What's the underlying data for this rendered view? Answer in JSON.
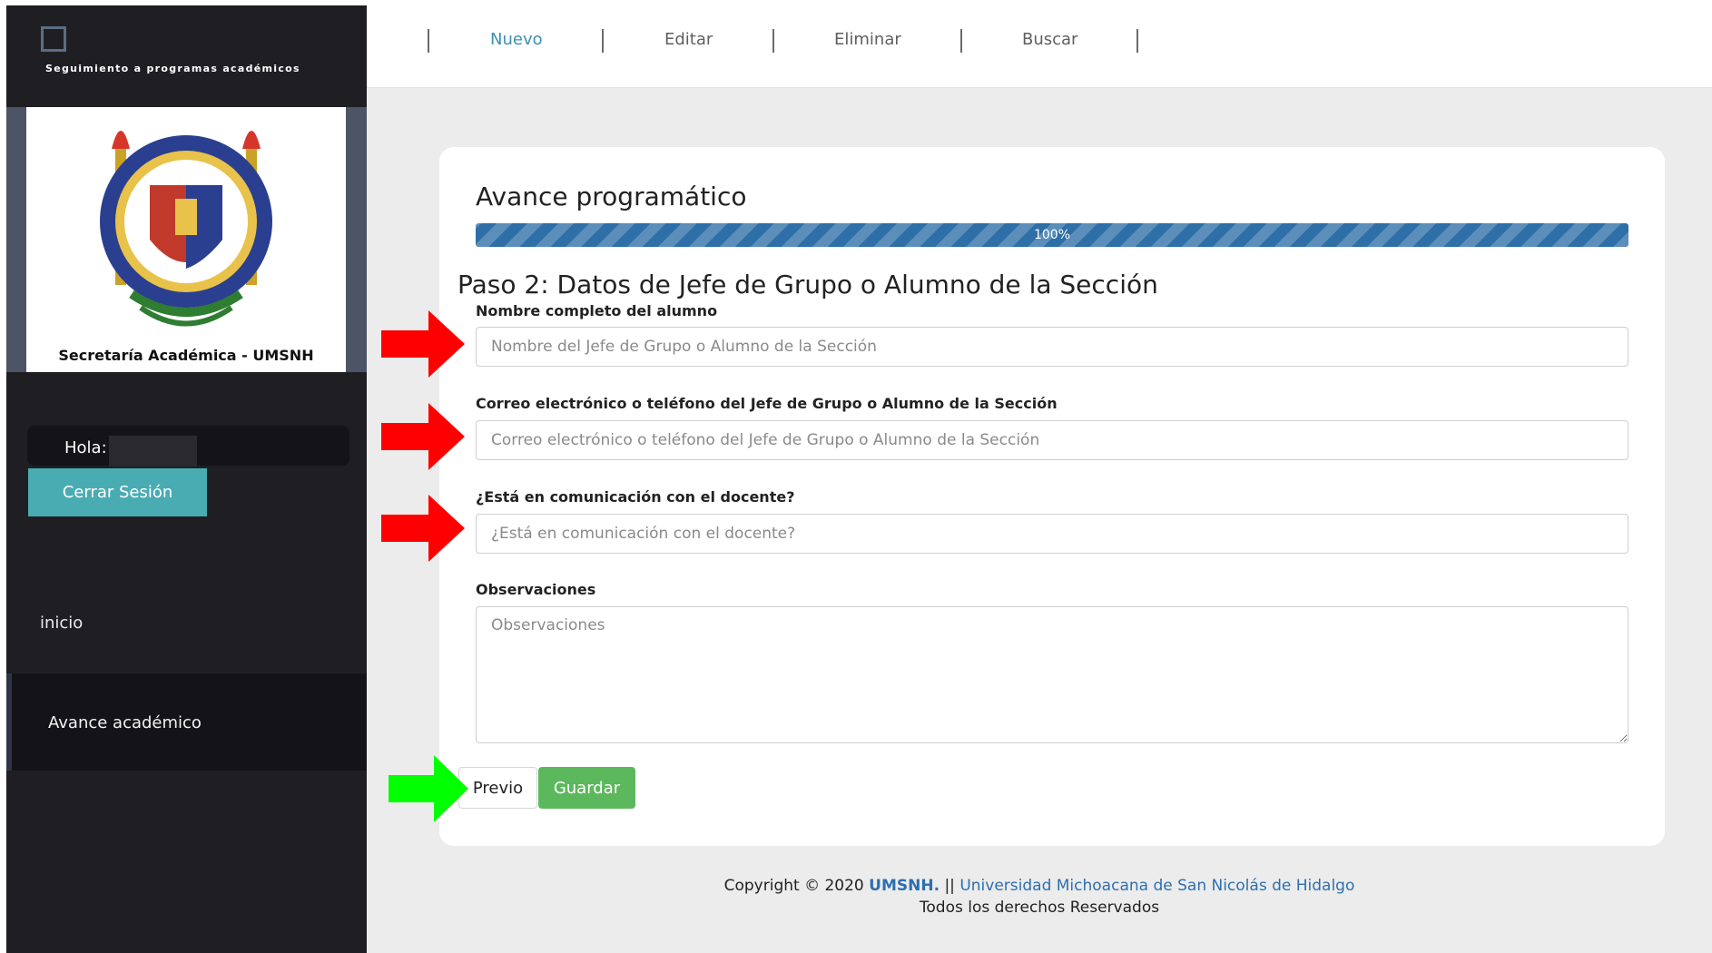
{
  "sidebar": {
    "brand_title": "Seguimiento a programas académicos",
    "logo_caption": "Secretaría Académica - UMSNH",
    "greeting": "Hola:",
    "logout_label": "Cerrar Sesión",
    "nav": {
      "home": "inicio",
      "active": "Avance académico"
    }
  },
  "toolbar": {
    "tabs": [
      "Nuevo",
      "Editar",
      "Eliminar",
      "Buscar"
    ],
    "active_tab": "Nuevo"
  },
  "form": {
    "title": "Avance programático",
    "progress": {
      "value": 100,
      "label": "100%"
    },
    "step_title": "Paso 2: Datos de Jefe de Grupo o Alumno de la Sección",
    "fields": [
      {
        "label": "Nombre completo del alumno",
        "placeholder": "Nombre del Jefe de Grupo o Alumno de la Sección",
        "value": ""
      },
      {
        "label": "Correo electrónico o teléfono del Jefe de Grupo o Alumno de la Sección",
        "placeholder": "Correo electrónico o teléfono del Jefe de Grupo o Alumno de la Sección",
        "value": ""
      },
      {
        "label": "¿Está en comunicación con el docente?",
        "placeholder": "¿Está en comunicación con el docente?",
        "value": ""
      },
      {
        "label": "Observaciones",
        "placeholder": "Observaciones",
        "value": ""
      }
    ],
    "prev_label": "Previo",
    "save_label": "Guardar"
  },
  "footer": {
    "copyright_prefix": "Copyright © 2020",
    "brand": "UMSNH.",
    "separator": "||",
    "university": "Universidad Michoacana de San Nicolás de Hidalgo",
    "rights": "Todos los derechos Reservados"
  },
  "colors": {
    "sidebar_bg": "#1f1f23",
    "accent_teal": "#4aacb3",
    "progress_blue": "#2d6fa6",
    "save_green": "#5cb85c",
    "link_blue": "#2d6fb0",
    "arrow_red": "#ff0000",
    "arrow_green": "#00ff00"
  }
}
